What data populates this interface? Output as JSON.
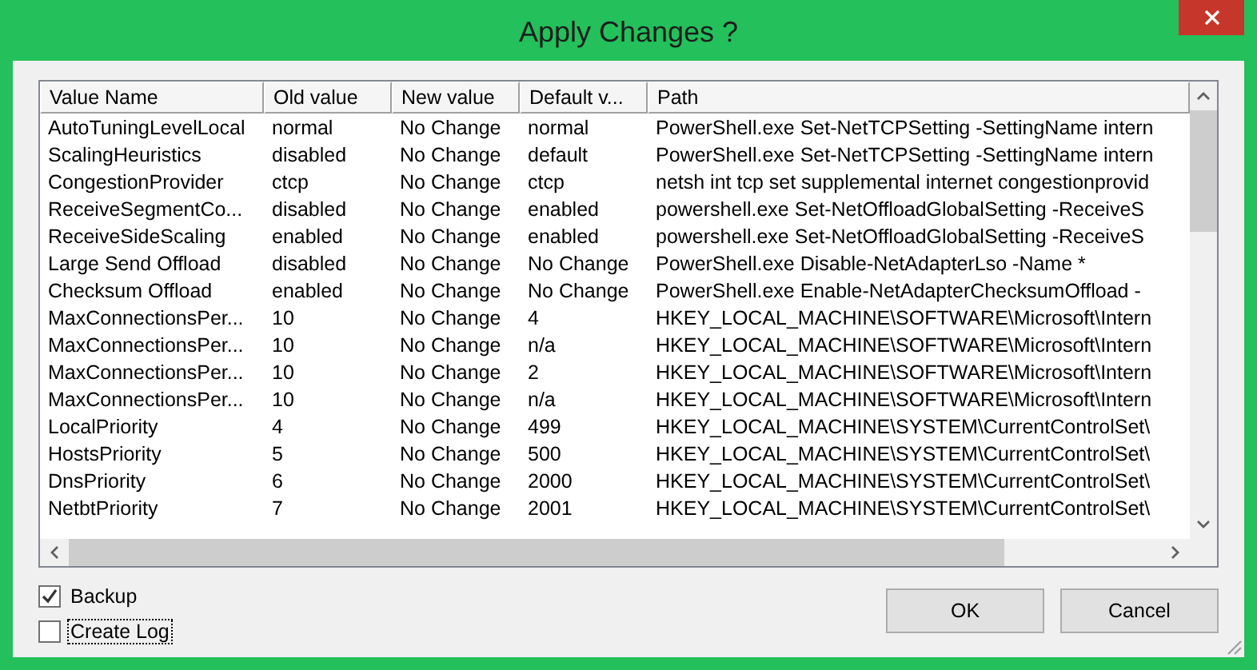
{
  "window": {
    "title": "Apply Changes ?"
  },
  "table": {
    "columns": [
      "Value Name",
      "Old value",
      "New value",
      "Default v...",
      "Path"
    ],
    "rows": [
      [
        "AutoTuningLevelLocal",
        "normal",
        "No Change",
        "normal",
        "PowerShell.exe Set-NetTCPSetting -SettingName intern"
      ],
      [
        "ScalingHeuristics",
        "disabled",
        "No Change",
        "default",
        "PowerShell.exe Set-NetTCPSetting -SettingName intern"
      ],
      [
        "CongestionProvider",
        "ctcp",
        "No Change",
        "ctcp",
        "netsh int tcp set supplemental internet congestionprovid"
      ],
      [
        "ReceiveSegmentCo...",
        "disabled",
        "No Change",
        "enabled",
        "powershell.exe Set-NetOffloadGlobalSetting -ReceiveS"
      ],
      [
        "ReceiveSideScaling",
        "enabled",
        "No Change",
        "enabled",
        "powershell.exe Set-NetOffloadGlobalSetting -ReceiveS"
      ],
      [
        "Large Send Offload",
        "disabled",
        "No Change",
        "No Change",
        "PowerShell.exe Disable-NetAdapterLso -Name *"
      ],
      [
        "Checksum Offload",
        "enabled",
        "No Change",
        "No Change",
        "PowerShell.exe Enable-NetAdapterChecksumOffload -"
      ],
      [
        "MaxConnectionsPer...",
        "10",
        "No Change",
        "4",
        "HKEY_LOCAL_MACHINE\\SOFTWARE\\Microsoft\\Intern"
      ],
      [
        "MaxConnectionsPer...",
        "10",
        "No Change",
        "n/a",
        "HKEY_LOCAL_MACHINE\\SOFTWARE\\Microsoft\\Intern"
      ],
      [
        "MaxConnectionsPer...",
        "10",
        "No Change",
        "2",
        "HKEY_LOCAL_MACHINE\\SOFTWARE\\Microsoft\\Intern"
      ],
      [
        "MaxConnectionsPer...",
        "10",
        "No Change",
        "n/a",
        "HKEY_LOCAL_MACHINE\\SOFTWARE\\Microsoft\\Intern"
      ],
      [
        "LocalPriority",
        "4",
        "No Change",
        "499",
        "HKEY_LOCAL_MACHINE\\SYSTEM\\CurrentControlSet\\"
      ],
      [
        "HostsPriority",
        "5",
        "No Change",
        "500",
        "HKEY_LOCAL_MACHINE\\SYSTEM\\CurrentControlSet\\"
      ],
      [
        "DnsPriority",
        "6",
        "No Change",
        "2000",
        "HKEY_LOCAL_MACHINE\\SYSTEM\\CurrentControlSet\\"
      ],
      [
        "NetbtPriority",
        "7",
        "No Change",
        "2001",
        "HKEY_LOCAL_MACHINE\\SYSTEM\\CurrentControlSet\\"
      ]
    ]
  },
  "options": [
    {
      "label": "Backup",
      "checked": true,
      "focused": false
    },
    {
      "label": "Create Log",
      "checked": false,
      "focused": true
    }
  ],
  "buttons": [
    "OK",
    "Cancel"
  ]
}
